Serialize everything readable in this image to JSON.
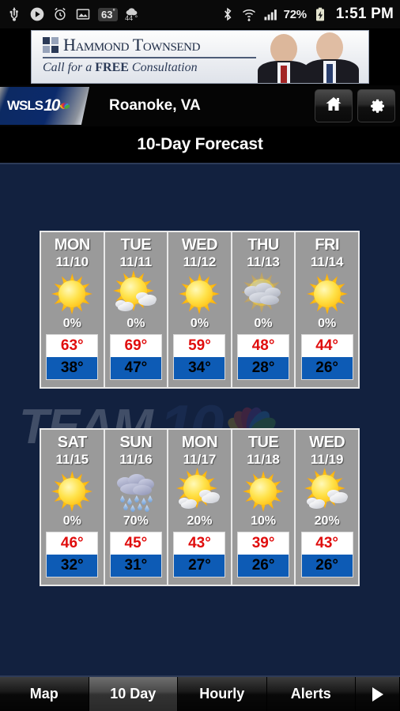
{
  "statusbar": {
    "icons": [
      "usb-icon",
      "play-circle-icon",
      "alarm-clock-icon",
      "picture-icon"
    ],
    "temp_badge": "63",
    "temp_badge_degree": "°",
    "weather_mini_temp": "44 °",
    "right_icons": [
      "bluetooth-icon",
      "wifi-icon",
      "cell-signal-icon"
    ],
    "battery_percent": "72%",
    "battery_state": "charging",
    "clock": "1:51 PM"
  },
  "ad": {
    "brand": "Hammond Townsend",
    "tagline_prefix": "Call for a ",
    "tagline_bold": "FREE",
    "tagline_suffix": " Consultation"
  },
  "header": {
    "logo_text_1": "WSLS",
    "logo_text_2": "10",
    "location": "Roanoke, VA",
    "home_button": "home-icon",
    "settings_button": "gear-icon"
  },
  "page_title": "10-Day Forecast",
  "watermark": {
    "team": "TEAM",
    "ten": "10"
  },
  "forecast_rows": [
    {
      "days": [
        {
          "dow": "MON",
          "date": "11/10",
          "icon": "sunny",
          "pop": "0%",
          "high": "63°",
          "low": "38°"
        },
        {
          "dow": "TUE",
          "date": "11/11",
          "icon": "partly-cloudy",
          "pop": "0%",
          "high": "69°",
          "low": "47°"
        },
        {
          "dow": "WED",
          "date": "11/12",
          "icon": "sunny",
          "pop": "0%",
          "high": "59°",
          "low": "34°"
        },
        {
          "dow": "THU",
          "date": "11/13",
          "icon": "mostly-cloudy",
          "pop": "0%",
          "high": "48°",
          "low": "28°"
        },
        {
          "dow": "FRI",
          "date": "11/14",
          "icon": "sunny",
          "pop": "0%",
          "high": "44°",
          "low": "26°"
        }
      ]
    },
    {
      "days": [
        {
          "dow": "SAT",
          "date": "11/15",
          "icon": "sunny",
          "pop": "0%",
          "high": "46°",
          "low": "32°"
        },
        {
          "dow": "SUN",
          "date": "11/16",
          "icon": "rain",
          "pop": "70%",
          "high": "45°",
          "low": "31°"
        },
        {
          "dow": "MON",
          "date": "11/17",
          "icon": "partly-cloudy",
          "pop": "20%",
          "high": "43°",
          "low": "27°"
        },
        {
          "dow": "TUE",
          "date": "11/18",
          "icon": "sunny",
          "pop": "10%",
          "high": "39°",
          "low": "26°"
        },
        {
          "dow": "WED",
          "date": "11/19",
          "icon": "partly-cloudy",
          "pop": "20%",
          "high": "43°",
          "low": "26°"
        }
      ]
    }
  ],
  "tabs": [
    {
      "label": "Map",
      "active": false
    },
    {
      "label": "10 Day",
      "active": true
    },
    {
      "label": "Hourly",
      "active": false
    },
    {
      "label": "Alerts",
      "active": false
    }
  ],
  "more_tab_icon": "right-arrow-icon",
  "colors": {
    "background": "#12213f",
    "card": "#9a9a9a",
    "high_temp": "#e00d0d",
    "low_temp_bg": "#0d5bb5",
    "title_bar": "#000000"
  }
}
